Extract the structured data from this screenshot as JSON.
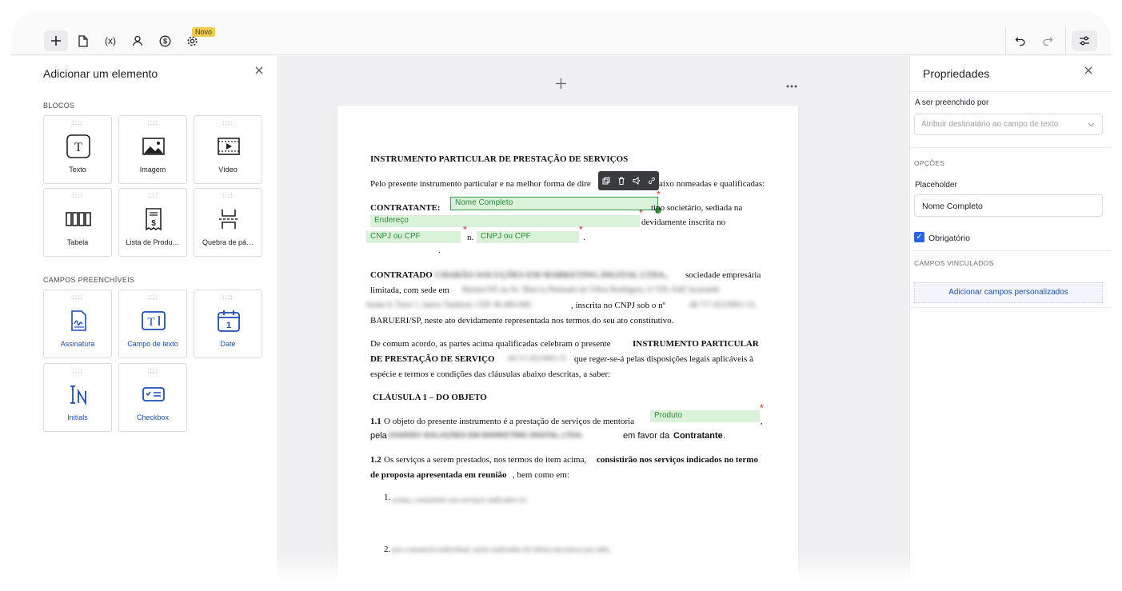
{
  "toolbar": {
    "new_badge": "Novo",
    "variables_label": "(x)"
  },
  "left_panel": {
    "title": "Adicionar um elemento",
    "blocks_label": "BLOCOS",
    "blocks": [
      {
        "label": "Texto",
        "icon": "text-block-icon"
      },
      {
        "label": "Imagem",
        "icon": "image-icon"
      },
      {
        "label": "Vídeo",
        "icon": "video-icon"
      },
      {
        "label": "Tabela",
        "icon": "table-icon"
      },
      {
        "label": "Lista de Produ…",
        "icon": "product-list-icon"
      },
      {
        "label": "Quebra de pá…",
        "icon": "page-break-icon"
      }
    ],
    "fields_label": "CAMPOS PREENCHÍVEIS",
    "fields": [
      {
        "label": "Assinatura",
        "icon": "signature-icon"
      },
      {
        "label": "Campo de texto",
        "icon": "text-field-icon"
      },
      {
        "label": "Date",
        "icon": "calendar-icon"
      },
      {
        "label": "Initials",
        "icon": "initials-icon"
      },
      {
        "label": "Checkbox",
        "icon": "checkbox-icon"
      }
    ]
  },
  "document": {
    "title": "INSTRUMENTO PARTICULAR DE PRESTAÇÃO DE SERVIÇOS",
    "intro_start": "Pelo presente instrumento particular e na melhor forma de dire",
    "intro_end": "aixo nomeadas e qualificadas:",
    "contratante_label": "CONTRATANTE:",
    "contratante_tail": "tipo  societário,  sediada na",
    "contratante_tail2": "devidamente inscrita no",
    "contratante_n": "n.",
    "contratante_dot": ".",
    "contratado_label": "CONTRATADO",
    "contratado_blur": "CHARÃO SOLUÇÕES EM MARKETING DIGITAL LTDA.,",
    "contratado_tail": "sociedade empresária",
    "line2_start": "limitada, com sede em",
    "line2_blur": "Barueri/SP, na Av. Marcos Penteado de Ulhoa Rodrigues, nº 939, Edif Jacarandá",
    "line3_blur1": "Andar 8, Torre 1, bairro Tamboré, CEP. 06.460-040,",
    "line3_mid": ", inscrita no CNPJ sob o nº",
    "line3_blur2": "48.717.452/0001-15,",
    "line4": "BARUERI/SP, neste ato devidamente representada nos termos do seu ato constitutivo.",
    "para2_a": " De comum acordo, as partes acima qualificadas celebram o presente",
    "para2_bold": "INSTRUMENTO PARTICULAR",
    "para2_b_bold": "DE PRESTAÇÃO DE SERVIÇO",
    "para2_blur": "48.717.452/0001-15",
    "para2_c": "que reger-se-á pelas disposições legais aplicáveis à",
    "para2_d": "espécie e termos e condições das cláusulas abaixo descritas, a saber:",
    "clause1": "CLÁUSULA 1 – DO OBJETO",
    "c11_num": "1.1",
    "c11_text": "O objeto do presente instrumento é a prestação de serviços de mentoria",
    "c11_comma": ",",
    "c11_pela": "pela",
    "c11_blur": "CHARÃO SOLUÇÕES EM MARKETING DIGITAL LTDA.",
    "c11_em": "em favor da",
    "c11_contratante": "Contratante",
    "c11_dot": ".",
    "c12_num": "1.2",
    "c12_text": "Os serviços a serem prestados, nos termos do item acima,",
    "c12_bold1": "consistirão nos serviços indicados no termo",
    "c12_bold2": "de proposta apresentada em reunião",
    "c12_end": ", bem como em:",
    "item1_num": "1.",
    "item1_blur": "acima, consistirão nos serviços indicados no",
    "item2_num": "2.",
    "item2_blur": "pós a mentoria individual, serão realizados 02 (dois) encontros por mês;",
    "fields": {
      "nome_completo": "Nome Completo",
      "endereco": "Endereço",
      "cnpj1": "CNPJ ou CPF",
      "cnpj2": "CNPJ ou CPF",
      "produto": "Produto"
    }
  },
  "right_panel": {
    "title": "Propriedades",
    "filled_by_label": "A ser preenchido por",
    "filled_by_placeholder": "Atribuir destinatário ao campo de texto",
    "options_label": "OPÇÕES",
    "placeholder_label": "Placeholder",
    "placeholder_value": "Nome Completo",
    "required_label": "Obrigatório",
    "linked_label": "CAMPOS VINCULADOS",
    "add_custom_label": "Adicionar campos personalizados"
  },
  "colors": {
    "field_bg": "#d9f2d9",
    "field_text": "#2f8a3a",
    "required": "#e02424",
    "link_blue": "#1d4fb8",
    "badge": "#f2c94c"
  }
}
